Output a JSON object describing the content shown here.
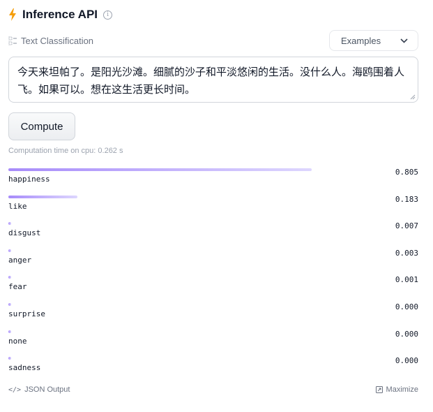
{
  "header": {
    "title": "Inference API",
    "info_icon": "info-icon",
    "bolt_color": "#f59e0b"
  },
  "task": {
    "label": "Text Classification",
    "icon": "text-classification-icon"
  },
  "examples": {
    "label": "Examples"
  },
  "input": {
    "value": "今天来坦帕了。是阳光沙滩。细腻的沙子和平淡悠闲的生活。没什么人。海鸥围着人飞。如果可以。想在这生活更长时间。"
  },
  "compute": {
    "label": "Compute"
  },
  "computation_time": "Computation time on cpu: 0.262 s",
  "results": [
    {
      "label": "happiness",
      "score": "0.805",
      "fraction": 0.805
    },
    {
      "label": "like",
      "score": "0.183",
      "fraction": 0.183
    },
    {
      "label": "disgust",
      "score": "0.007",
      "fraction": 0.007
    },
    {
      "label": "anger",
      "score": "0.003",
      "fraction": 0.003
    },
    {
      "label": "fear",
      "score": "0.001",
      "fraction": 0.001
    },
    {
      "label": "surprise",
      "score": "0.000",
      "fraction": 0.0
    },
    {
      "label": "none",
      "score": "0.000",
      "fraction": 0.0
    },
    {
      "label": "sadness",
      "score": "0.000",
      "fraction": 0.0
    }
  ],
  "footer": {
    "json_output": "JSON Output",
    "maximize": "Maximize"
  }
}
